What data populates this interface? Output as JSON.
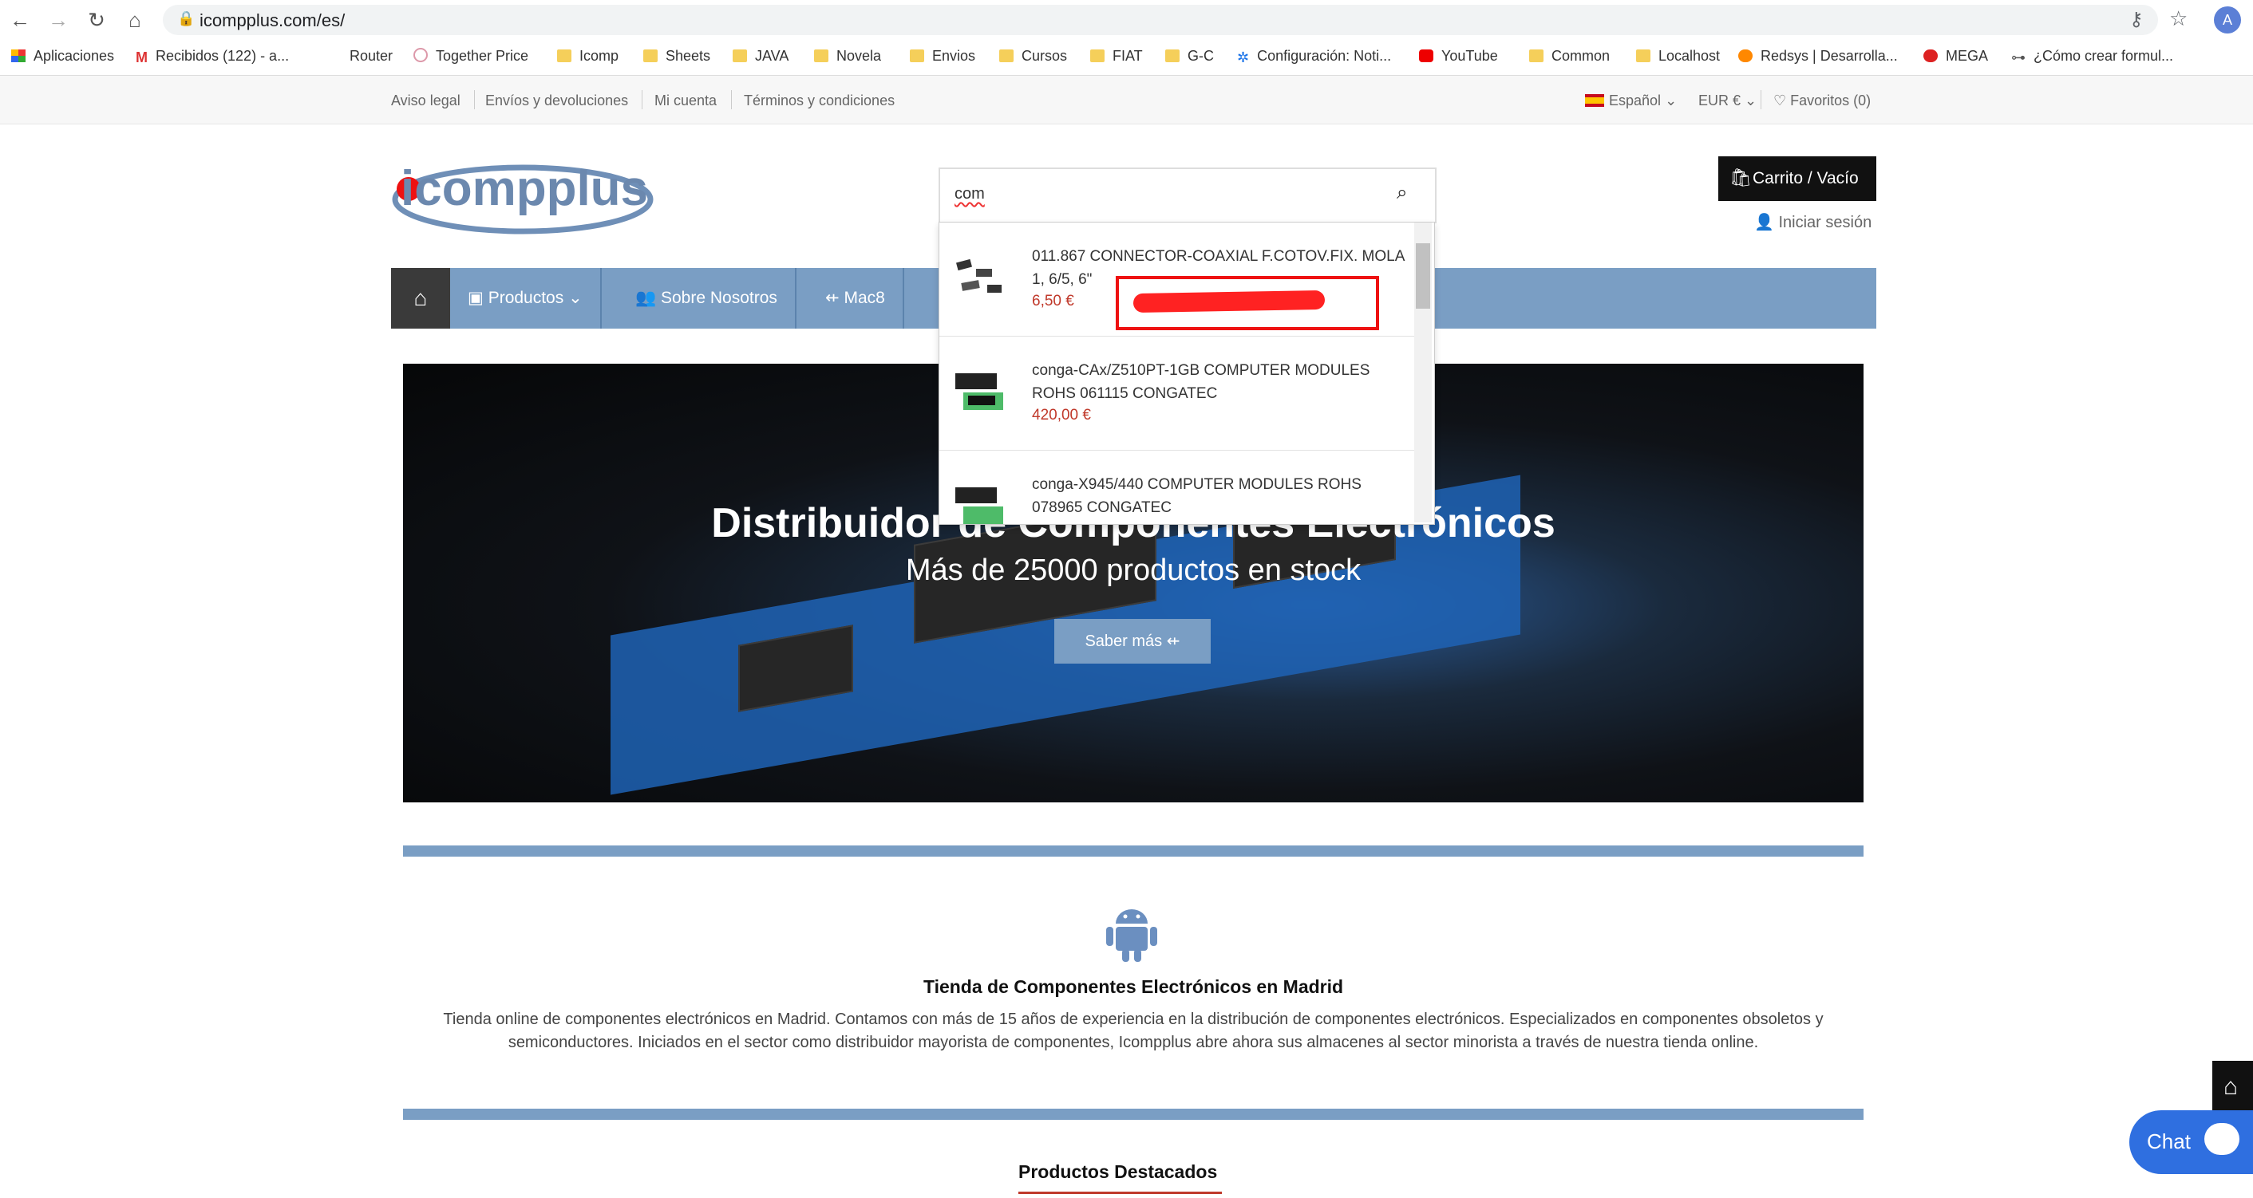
{
  "browser": {
    "url": "icompplus.com/es/",
    "profile_initial": "A",
    "bookmarks": [
      {
        "label": "Aplicaciones",
        "icon": "apps-grid-icon"
      },
      {
        "label": "Recibidos (122) - a...",
        "icon": "gmail-icon"
      },
      {
        "label": "Router",
        "icon": "blank-page-icon"
      },
      {
        "label": "Together Price",
        "icon": "togetherprice-icon"
      },
      {
        "label": "Icomp",
        "icon": "folder-icon"
      },
      {
        "label": "Sheets",
        "icon": "folder-icon"
      },
      {
        "label": "JAVA",
        "icon": "folder-icon"
      },
      {
        "label": "Novela",
        "icon": "folder-icon"
      },
      {
        "label": "Envios",
        "icon": "folder-icon"
      },
      {
        "label": "Cursos",
        "icon": "folder-icon"
      },
      {
        "label": "FIAT",
        "icon": "folder-icon"
      },
      {
        "label": "G-C",
        "icon": "folder-icon"
      },
      {
        "label": "Configuración: Noti...",
        "icon": "gear-icon"
      },
      {
        "label": "YouTube",
        "icon": "youtube-icon"
      },
      {
        "label": "Common",
        "icon": "folder-icon"
      },
      {
        "label": "Localhost",
        "icon": "folder-icon"
      },
      {
        "label": "Redsys | Desarrolla...",
        "icon": "firefox-icon"
      },
      {
        "label": "MEGA",
        "icon": "mega-icon"
      },
      {
        "label": "¿Cómo crear formul...",
        "icon": "car-icon"
      }
    ]
  },
  "utility_bar": {
    "links": [
      "Aviso legal",
      "Envíos y devoluciones",
      "Mi cuenta",
      "Términos y condiciones"
    ],
    "language": "Español",
    "currency": "EUR €",
    "favorites": "Favoritos (0)"
  },
  "header": {
    "logo_text": "icompplus",
    "search_value": "com",
    "cart_label": "Carrito / Vacío",
    "login_label": "Iniciar sesión"
  },
  "nav": {
    "items": [
      {
        "label": "Productos",
        "icon": "archive-box-icon"
      },
      {
        "label": "Sobre Nosotros",
        "icon": "users-icon"
      },
      {
        "label": "Mac8",
        "icon": "usb-icon"
      }
    ]
  },
  "search_results": [
    {
      "name": "011.867 CONNECTOR-COAXIAL F.COTOV.FIX. MOLA 1, 6/5, 6\"",
      "price": "6,50 €"
    },
    {
      "name": "conga-CAx/Z510PT-1GB COMPUTER MODULES ROHS 061115 CONGATEC",
      "price": "420,00 €"
    },
    {
      "name": "conga-X945/440 COMPUTER MODULES ROHS 078965 CONGATEC",
      "price": ""
    }
  ],
  "hero": {
    "title": "Distribuidor de Componentes Electrónicos",
    "subtitle": "Más de 25000 productos en stock",
    "button": "Saber más"
  },
  "about": {
    "title": "Tienda de Componentes Electrónicos en Madrid",
    "text": "Tienda online de componentes electrónicos en Madrid. Contamos con más de 15 años de experiencia en la distribución de componentes electrónicos. Especializados en componentes obsoletos y semiconductores. Iniciados en el sector como distribuidor mayorista de componentes, Icompplus abre ahora sus almacenes al sector minorista a través de nuestra tienda online."
  },
  "featured": {
    "title": "Productos Destacados"
  },
  "chat": {
    "label": "Chat"
  },
  "colors": {
    "nav_blue": "#7a9ec4",
    "accent_red": "#c0392b",
    "dark": "#111111"
  }
}
